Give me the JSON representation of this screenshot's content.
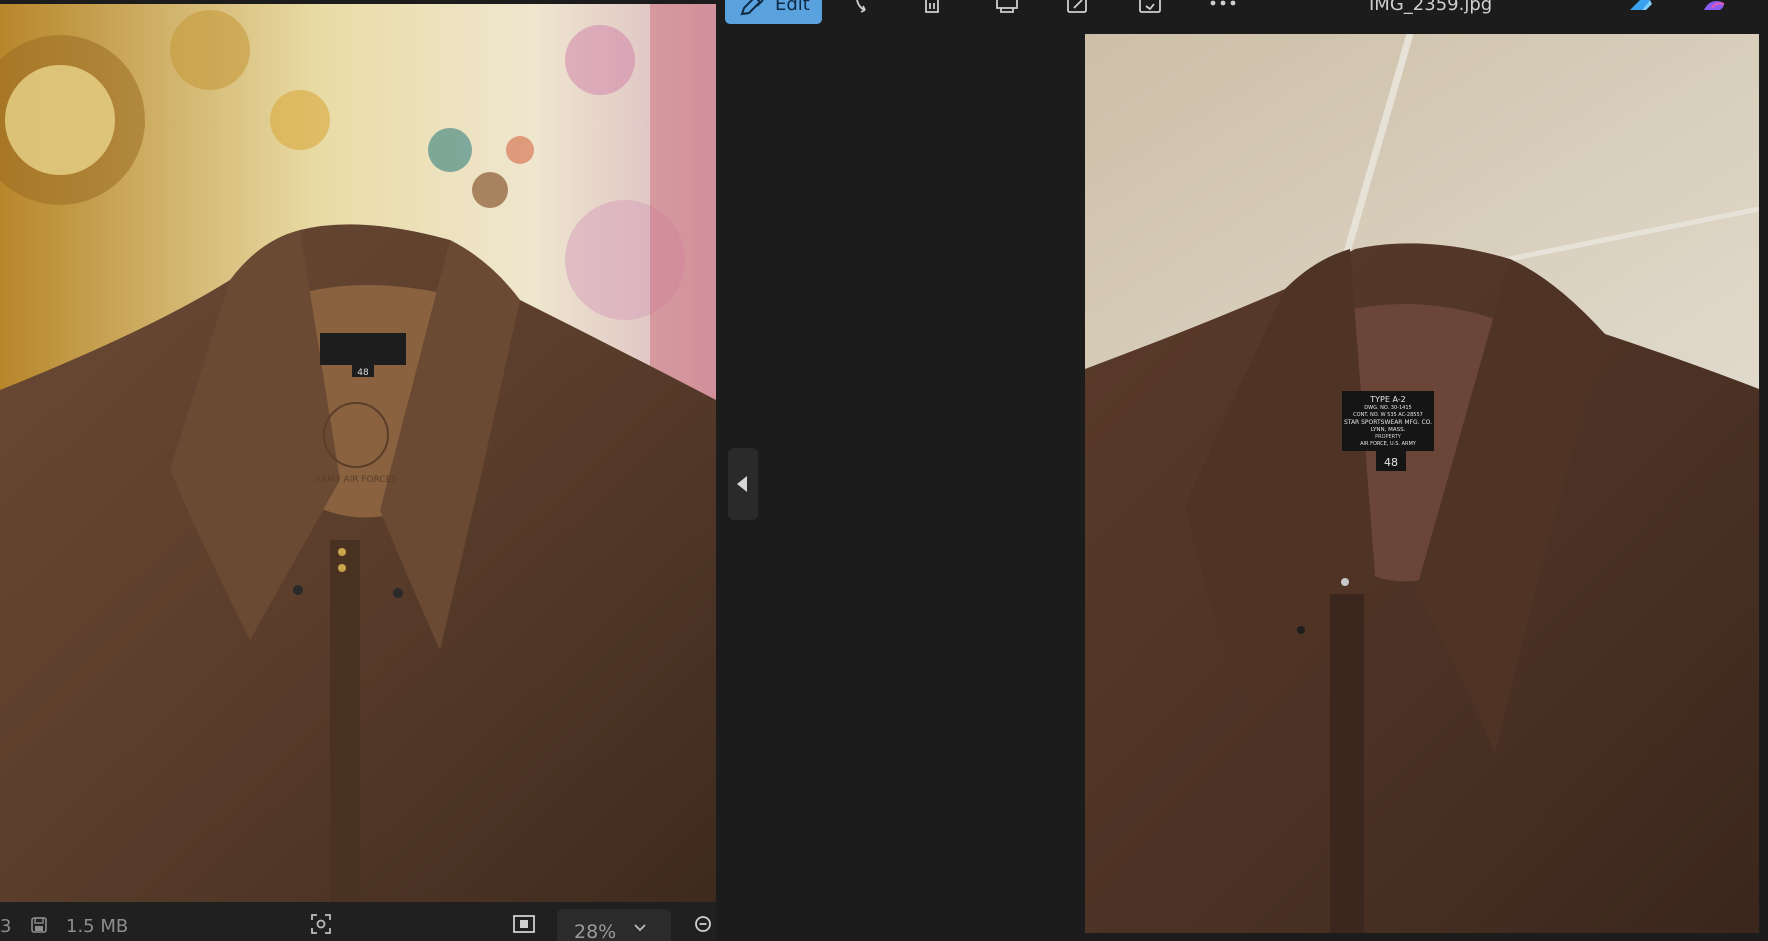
{
  "left_window": {
    "photo_description_icon": "photo",
    "status_bar": {
      "item_count_fragment": "3",
      "file_size": "1.5 MB",
      "zoom": "28%"
    }
  },
  "right_window": {
    "toolbar": {
      "edit_label": "Edit",
      "file_name": "IMG_2359.jpg",
      "icons": [
        "rotate-icon",
        "delete-icon",
        "print-icon",
        "share-icon",
        "crop-icon",
        "more-icon",
        "designer-icon",
        "copilot-icon"
      ]
    },
    "jacket_label": {
      "line1": "TYPE A-2",
      "line2": "DWG. NO. 30-1415",
      "line3": "CONT. NO. W 535 AC-28557",
      "line4": "STAR SPORTSWEAR MFG. CO.",
      "line5": "LYNN, MASS.",
      "line6": "PROPERTY",
      "line7": "AIR FORCE, U.S. ARMY",
      "size": "48"
    }
  },
  "left_jacket": {
    "stamp_text": "ARMY AIR FORCES",
    "size": "48"
  },
  "colors": {
    "edit_accent": "#5aa2de",
    "background": "#1c1c1c",
    "leather": "#5a3d2b"
  }
}
